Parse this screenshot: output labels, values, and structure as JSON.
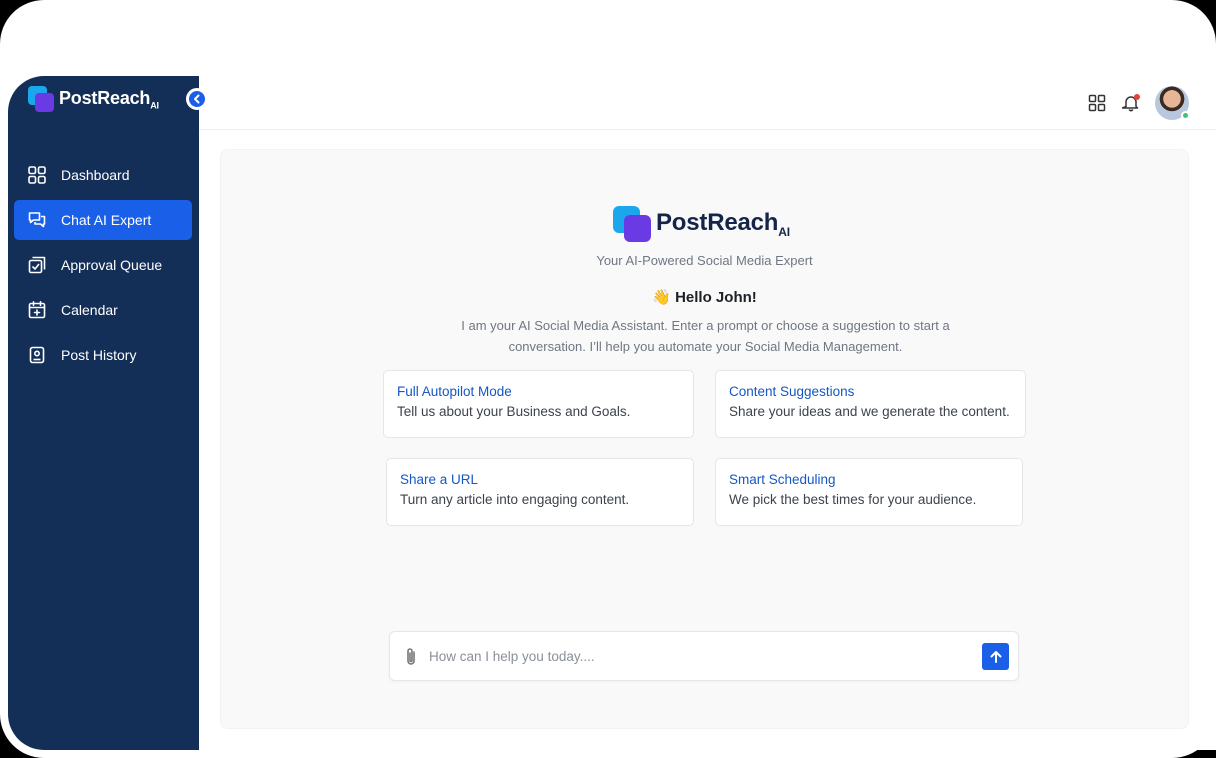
{
  "brand": {
    "name": "PostReach",
    "suffix": "AI"
  },
  "sidebar": {
    "items": [
      {
        "label": "Dashboard",
        "icon": "grid-icon",
        "active": false
      },
      {
        "label": "Chat AI Expert",
        "icon": "chat-icon",
        "active": true
      },
      {
        "label": "Approval Queue",
        "icon": "approval-icon",
        "active": false
      },
      {
        "label": "Calendar",
        "icon": "calendar-icon",
        "active": false
      },
      {
        "label": "Post History",
        "icon": "history-icon",
        "active": false
      }
    ]
  },
  "topbar": {
    "icons": [
      "apps-grid-icon",
      "bell-icon",
      "avatar"
    ]
  },
  "main": {
    "tagline": "Your AI-Powered Social Media Expert",
    "greeting_emoji": "👋",
    "greeting": "Hello John!",
    "intro": "I am your AI Social Media Assistant. Enter a prompt or choose a suggestion to start a conversation. I’ll help you automate your Social Media Management.",
    "cards": [
      {
        "title": "Full Autopilot Mode",
        "desc": "Tell us about your Business and Goals."
      },
      {
        "title": "Content Suggestions",
        "desc": "Share your ideas and we generate the content."
      },
      {
        "title": "Share a URL",
        "desc": "Turn any article into engaging content."
      },
      {
        "title": "Smart Scheduling",
        "desc": "We pick the best times for your audience."
      }
    ],
    "input": {
      "placeholder": "How can I help you today....",
      "value": ""
    }
  },
  "colors": {
    "sidebar": "#132f57",
    "accent": "#1a5fe8",
    "link": "#1557c6"
  }
}
